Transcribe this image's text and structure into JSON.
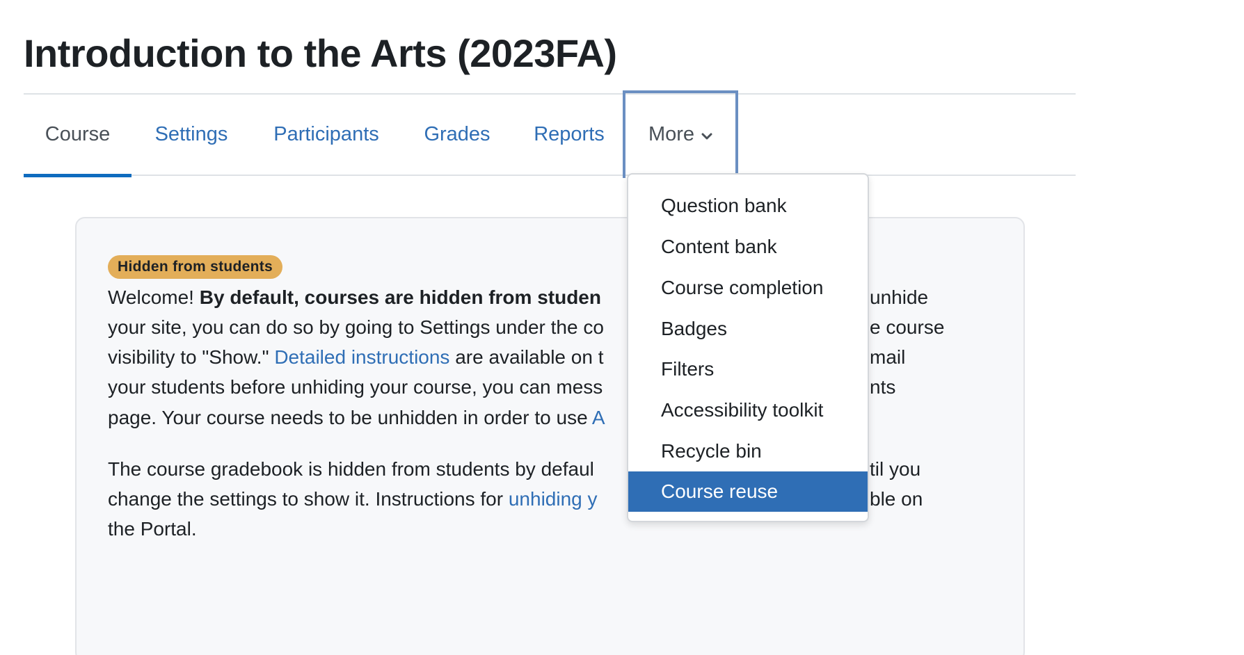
{
  "course": {
    "title": "Introduction to the Arts (2023FA)"
  },
  "nav": {
    "tabs": [
      {
        "label": "Course",
        "active": true
      },
      {
        "label": "Settings"
      },
      {
        "label": "Participants"
      },
      {
        "label": "Grades"
      },
      {
        "label": "Reports"
      }
    ],
    "more_label": "More",
    "more_icon": "chevron-down-icon"
  },
  "more_menu": {
    "items": [
      {
        "label": "Question bank"
      },
      {
        "label": "Content bank"
      },
      {
        "label": "Course completion"
      },
      {
        "label": "Badges"
      },
      {
        "label": "Filters"
      },
      {
        "label": "Accessibility toolkit"
      },
      {
        "label": "Recycle bin"
      },
      {
        "label": "Course reuse",
        "selected": true
      }
    ]
  },
  "notice": {
    "badge": "Hidden from students",
    "p1": {
      "l1_a": "Welcome! ",
      "l1_bold": "By default, courses are hidden from studen",
      "l1_tail": "unhide",
      "l2_a": "your site, you can do so by going to Settings under the co",
      "l2_tail": "e course",
      "l3_a": "visibility to \"Show.\" ",
      "l3_link": "Detailed instructions",
      "l3_b": " are available on t",
      "l3_tail": "mail",
      "l4_a": "your students before unhiding your course, you can mess",
      "l4_tail": "nts",
      "l5_a": "page. Your course needs to be unhidden in order to use ",
      "l5_link": "A"
    },
    "p2": {
      "l1_a": "The course gradebook is hidden from students by defaul",
      "l1_tail": "til you",
      "l2_a": "change the settings to show it. Instructions for ",
      "l2_link": "unhiding y",
      "l2_tail": "ble on",
      "l3_a": "the Portal."
    }
  },
  "colors": {
    "link": "#2f6eb5",
    "active_underline": "#0f6cbf",
    "badge_bg": "#e3ae59",
    "menu_selected_bg": "#2f6eb5"
  }
}
